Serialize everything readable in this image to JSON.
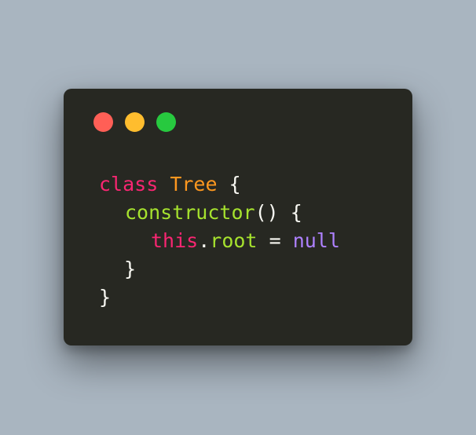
{
  "colors": {
    "background": "#a9b5c0",
    "window": "#272822",
    "close": "#ff5f56",
    "minimize": "#ffbd2e",
    "zoom": "#27c93f",
    "keyword": "#f92672",
    "class_name": "#fd971f",
    "function": "#a6e22e",
    "constant": "#ae81ff",
    "text": "#f8f8f2"
  },
  "window_controls": [
    {
      "name": "close-button",
      "color": "#ff5f56"
    },
    {
      "name": "minimize-button",
      "color": "#ffbd2e"
    },
    {
      "name": "zoom-button",
      "color": "#27c93f"
    }
  ],
  "code": {
    "line1": {
      "keyword": "class",
      "class_name": "Tree",
      "brace_open": "{"
    },
    "line2": {
      "method": "constructor",
      "parens": "()",
      "brace_open": "{"
    },
    "line3": {
      "this": "this",
      "dot": ".",
      "property": "root",
      "equals": "=",
      "value": "null"
    },
    "line4": {
      "brace_close": "}"
    },
    "line5": {
      "brace_close": "}"
    }
  }
}
